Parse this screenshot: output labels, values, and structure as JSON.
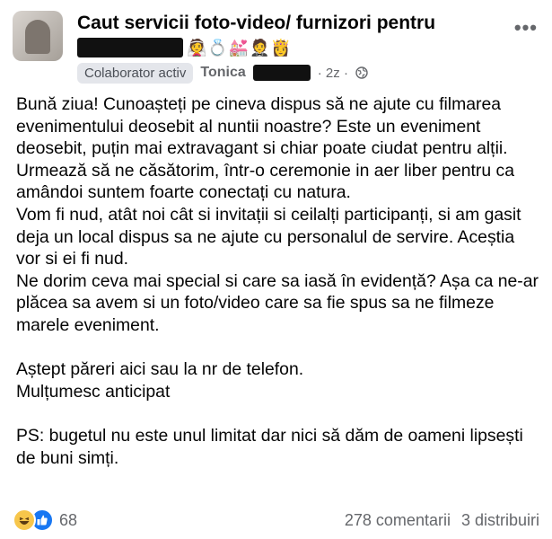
{
  "header": {
    "group_name": "Caut servicii foto-video/ furnizori pentru",
    "title_emojis": "👰💍💒🤵👸",
    "role_badge": "Colaborator activ",
    "author_name": "Tonica",
    "time": "· 2z ·",
    "more_label": "•••"
  },
  "post": {
    "paragraphs": [
      "Bună ziua! Cunoașteți pe cineva dispus să ne ajute cu filmarea evenimentului deosebit al nuntii noastre? Este un eveniment deosebit, puțin mai extravagant si chiar poate ciudat pentru alții. Urmează să ne căsătorim, într-o ceremonie in aer liber pentru ca amândoi suntem foarte conectați cu natura.",
      "Vom fi nud, atât noi cât si invitații si ceilalți participanți, si am gasit deja un local dispus sa ne ajute cu personalul de servire. Aceștia vor si ei fi nud.",
      "Ne dorim ceva mai special si care sa iasă în evidență? Așa ca ne-ar plăcea sa avem si un foto/video care sa fie spus sa ne filmeze marele eveniment.",
      "Aștept păreri aici sau la nr de telefon.",
      "Mulțumesc anticipat",
      "PS: bugetul nu este unul limitat dar nici să dăm de oameni lipsești de buni simți."
    ]
  },
  "footer": {
    "reaction_count": "68",
    "comments": "278 comentarii",
    "shares": "3 distribuiri"
  },
  "colors": {
    "text": "#050505",
    "muted": "#65676b",
    "like_blue": "#1877f2",
    "haha_yellow": "#f7c64b",
    "badge_bg": "#e4e6eb"
  }
}
